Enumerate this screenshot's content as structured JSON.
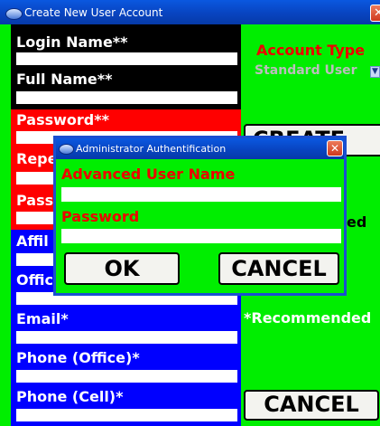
{
  "window": {
    "title": "Create New User Account",
    "close_glyph": "✕"
  },
  "form": {
    "login_name_label": "Login Name**",
    "full_name_label": "Full Name**",
    "password_label": "Password**",
    "repeat_label_visible": "Repe",
    "pass_label_visible": "Pass",
    "affil_label_visible": "Affil",
    "offic_label_visible": "Offic",
    "email_label": "Email*",
    "phone_office_label": "Phone (Office)*",
    "phone_cell_label": "Phone (Cell)*"
  },
  "right": {
    "account_type_label": "Account Type",
    "account_type_value": "Standard User",
    "create_button_visible": "CREATE",
    "partial_text": "ed",
    "recommended_text": "*Recommended",
    "cancel_button": "CANCEL"
  },
  "dialog": {
    "title": "Administrator Authentification",
    "user_label": "Advanced User Name",
    "password_label": "Password",
    "ok_button": "OK",
    "cancel_button": "CANCEL",
    "close_glyph": "✕"
  },
  "colors": {
    "background_green": "#00ee00",
    "login_section": "#000000",
    "password_section": "#ff0000",
    "info_section": "#0000ff",
    "title_bar": "#0844c0",
    "dialog_label": "#ee0000"
  }
}
